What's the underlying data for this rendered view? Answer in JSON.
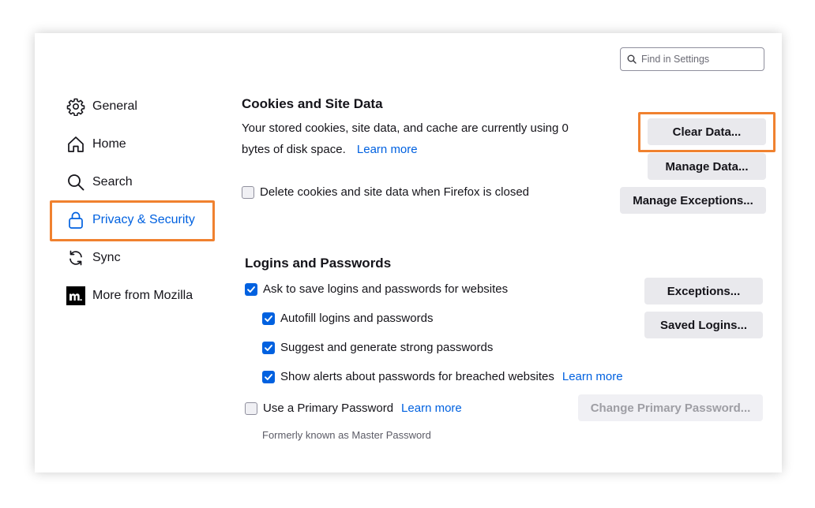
{
  "search": {
    "placeholder": "Find in Settings",
    "value": ""
  },
  "sidebar": {
    "items": [
      {
        "label": "General",
        "icon": "gear-icon",
        "active": false
      },
      {
        "label": "Home",
        "icon": "home-icon",
        "active": false
      },
      {
        "label": "Search",
        "icon": "search-icon",
        "active": false
      },
      {
        "label": "Privacy & Security",
        "icon": "lock-icon",
        "active": true
      },
      {
        "label": "Sync",
        "icon": "sync-icon",
        "active": false
      },
      {
        "label": "More from Mozilla",
        "icon": "mozilla-logo-icon",
        "active": false
      }
    ]
  },
  "cookies": {
    "heading": "Cookies and Site Data",
    "desc_line1": "Your stored cookies, site data, and cache are currently using 0",
    "desc_line2": "bytes of disk space.",
    "learn_more": "Learn more",
    "clear_button": "Clear Data...",
    "manage_button": "Manage Data...",
    "exceptions_button": "Manage Exceptions...",
    "delete_checkbox": {
      "label": "Delete cookies and site data when Firefox is closed",
      "checked": false
    }
  },
  "logins": {
    "heading": "Logins and Passwords",
    "ask_save": {
      "label": "Ask to save logins and passwords for websites",
      "checked": true
    },
    "autofill": {
      "label": "Autofill logins and passwords",
      "checked": true
    },
    "suggest": {
      "label": "Suggest and generate strong passwords",
      "checked": true
    },
    "alerts": {
      "label": "Show alerts about passwords for breached websites",
      "checked": true,
      "link": "Learn more"
    },
    "primary_password": {
      "label": "Use a Primary Password",
      "checked": false,
      "link": "Learn more"
    },
    "formerly": "Formerly known as Master Password",
    "exceptions_button": "Exceptions...",
    "saved_logins_button": "Saved Logins...",
    "change_primary_button": "Change Primary Password..."
  },
  "colors": {
    "accent": "#0061e0",
    "highlight": "#f0812f",
    "button_bg": "#e9e9ed",
    "text": "#15141a"
  }
}
